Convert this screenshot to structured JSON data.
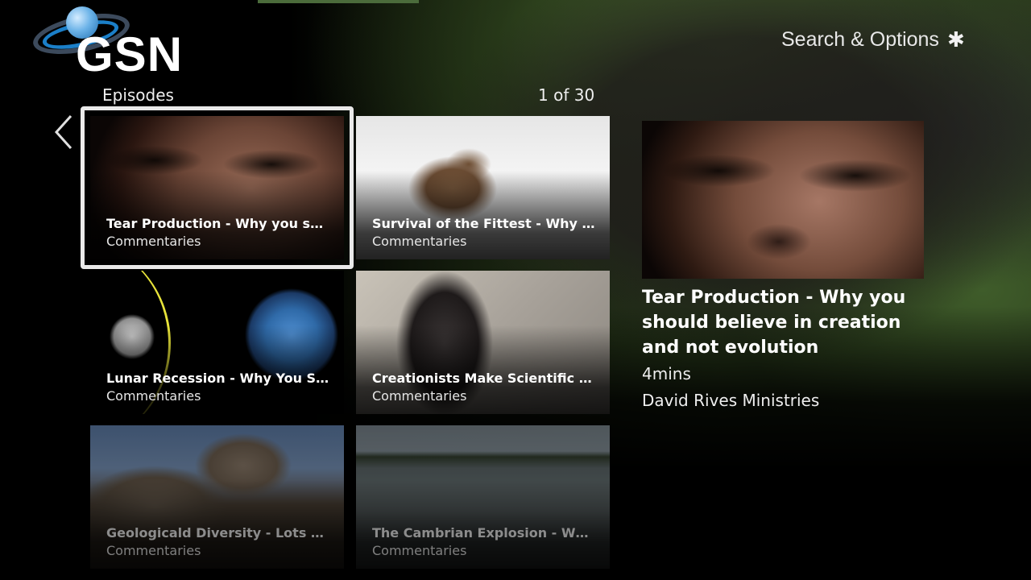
{
  "brand": {
    "logo_text": "GSN"
  },
  "header": {
    "section_title": "Episodes",
    "page_indicator": "1 of 30",
    "search_options_label": "Search & Options",
    "search_options_icon": "asterisk-icon"
  },
  "tiles": [
    {
      "title": "Tear Production - Why you sh...",
      "subtitle": "Commentaries",
      "focused": true
    },
    {
      "title": "Survival of the Fittest -  Why ...",
      "subtitle": "Commentaries"
    },
    {
      "title": "Lunar Recession - Why You S...",
      "subtitle": "Commentaries"
    },
    {
      "title": "Creationists Make Scientific P...",
      "subtitle": "Commentaries"
    },
    {
      "title": "Geologicald Diversity -  Lots o...",
      "subtitle": "Commentaries"
    },
    {
      "title": "The Cambrian Explosion - Wh...",
      "subtitle": "Commentaries"
    }
  ],
  "detail": {
    "title": "Tear Production - Why you should believe in creation and not evolution",
    "duration": "4mins",
    "provider": "David Rives Ministries"
  },
  "colors": {
    "focus_border": "#e9e9e9",
    "text": "#ffffff",
    "logo_ring_blue": "#1b7fc8"
  }
}
